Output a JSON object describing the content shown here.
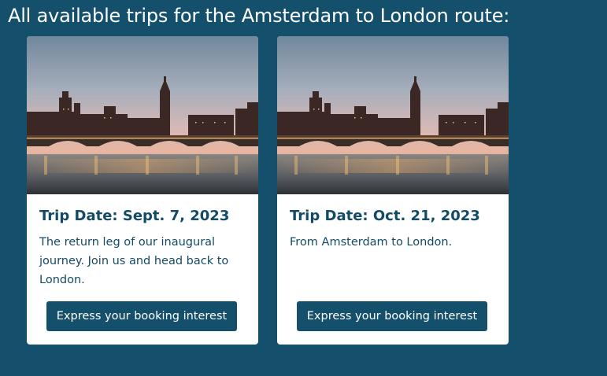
{
  "page": {
    "title": "All available trips for the Amsterdam to London route:"
  },
  "trips": [
    {
      "title": "Trip Date: Sept. 7, 2023",
      "description": "The return leg of our inaugural journey. Join us and head back to London.",
      "button_label": "Express your booking interest",
      "image_name": "london-bridge-big-ben-photo"
    },
    {
      "title": "Trip Date: Oct. 21, 2023",
      "description": "From Amsterdam to London.",
      "button_label": "Express your booking interest",
      "image_name": "london-bridge-big-ben-photo"
    }
  ],
  "colors": {
    "background": "#144f6b",
    "card": "#ffffff",
    "text": "#134a66",
    "button": "#144f6b"
  }
}
